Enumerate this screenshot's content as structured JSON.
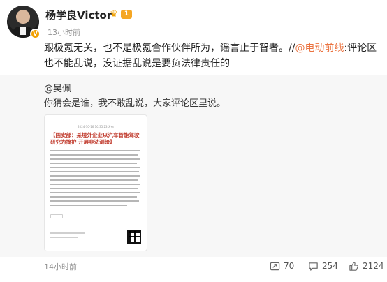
{
  "author": {
    "name": "杨学良Victor",
    "level": "1",
    "time": "13小时前",
    "verified_icon": "verified-v-icon"
  },
  "post": {
    "text_before": "跟极氪无关，也不是极氪合作伙伴所为，谣言止于智者。//",
    "mention": "@电动前线",
    "text_after": ":评论区也不能乱说，没证据乱说是要负法律责任的"
  },
  "quote": {
    "author": "@吴佩",
    "text": "你猜会是谁，我不敢乱说，大家评论区里说。",
    "image": {
      "date": "2024-10-16 16:35:23 发布",
      "headline": "【国安部：某境外企业以汽车智能驾驶研究为掩护 开展非法测绘】"
    }
  },
  "footer": {
    "time": "14小时前",
    "repost_count": "70",
    "comment_count": "254",
    "like_count": "2124"
  },
  "colors": {
    "mention": "#eb7340",
    "badge": "#f5a623",
    "headline_red": "#c0392b"
  }
}
